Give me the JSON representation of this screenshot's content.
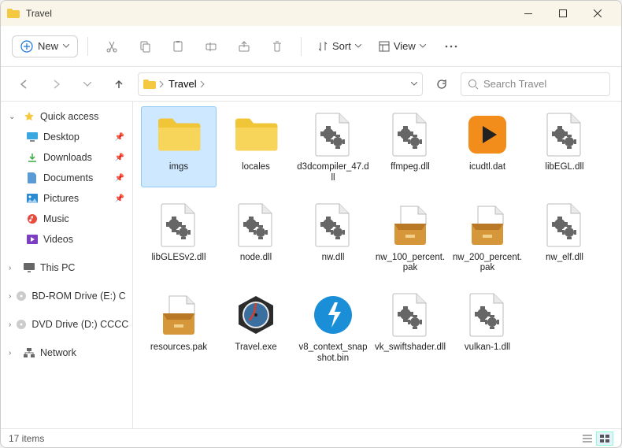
{
  "titlebar": {
    "title": "Travel"
  },
  "toolbar": {
    "new_label": "New",
    "sort_label": "Sort",
    "view_label": "View"
  },
  "breadcrumb": {
    "parts": [
      "Travel"
    ]
  },
  "search": {
    "placeholder": "Search Travel"
  },
  "sidebar": {
    "quick_access": "Quick access",
    "desktop": "Desktop",
    "downloads": "Downloads",
    "documents": "Documents",
    "pictures": "Pictures",
    "music": "Music",
    "videos": "Videos",
    "this_pc": "This PC",
    "bdrom": "BD-ROM Drive (E:) C",
    "dvd": "DVD Drive (D:) CCCC",
    "network": "Network"
  },
  "items": [
    {
      "name": "imgs",
      "type": "folder"
    },
    {
      "name": "locales",
      "type": "folder"
    },
    {
      "name": "d3dcompiler_47.dll",
      "type": "dll"
    },
    {
      "name": "ffmpeg.dll",
      "type": "dll"
    },
    {
      "name": "icudtl.dat",
      "type": "dat"
    },
    {
      "name": "libEGL.dll",
      "type": "dll"
    },
    {
      "name": "libGLESv2.dll",
      "type": "dll"
    },
    {
      "name": "node.dll",
      "type": "dll"
    },
    {
      "name": "nw.dll",
      "type": "dll"
    },
    {
      "name": "nw_100_percent.pak",
      "type": "pak"
    },
    {
      "name": "nw_200_percent.pak",
      "type": "pak"
    },
    {
      "name": "nw_elf.dll",
      "type": "dll"
    },
    {
      "name": "resources.pak",
      "type": "pak"
    },
    {
      "name": "Travel.exe",
      "type": "exe"
    },
    {
      "name": "v8_context_snapshot.bin",
      "type": "bin"
    },
    {
      "name": "vk_swiftshader.dll",
      "type": "dll"
    },
    {
      "name": "vulkan-1.dll",
      "type": "dll"
    }
  ],
  "status": {
    "count": "17 items"
  }
}
